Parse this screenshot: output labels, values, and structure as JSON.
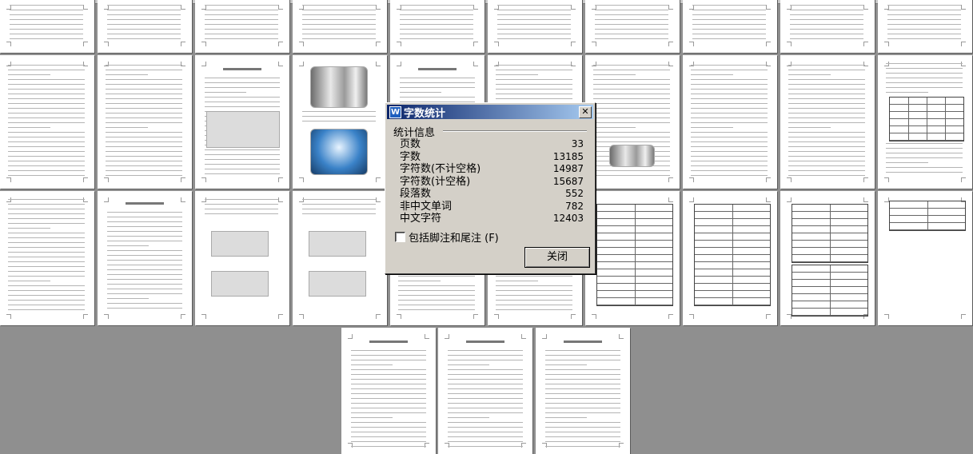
{
  "dialog": {
    "title": "字数统计",
    "app_icon_glyph": "W",
    "close_glyph": "✕",
    "section_label": "统计信息",
    "stats": [
      {
        "label": "页数",
        "value": "33"
      },
      {
        "label": "字数",
        "value": "13185"
      },
      {
        "label": "字符数(不计空格)",
        "value": "14987"
      },
      {
        "label": "字符数(计空格)",
        "value": "15687"
      },
      {
        "label": "段落数",
        "value": "552"
      },
      {
        "label": "非中文单词",
        "value": "782"
      },
      {
        "label": "中文字符",
        "value": "12403"
      }
    ],
    "include_footnotes_label": "包括脚注和尾注 (F)",
    "include_footnotes_checked": false,
    "close_button_label": "关闭"
  },
  "document_preview": {
    "background_color": "#8f8f8f",
    "page_color": "#ffffff",
    "heading_color": "#777777"
  }
}
